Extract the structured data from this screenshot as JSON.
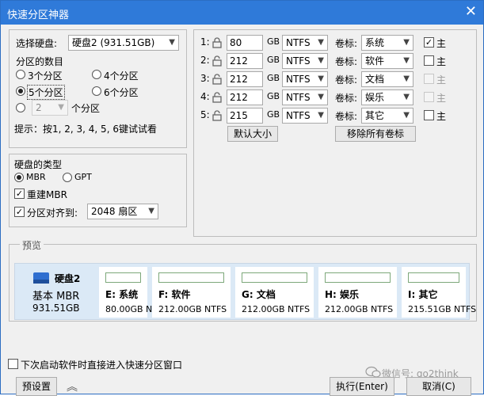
{
  "title": "快速分区神器",
  "disk": {
    "label": "选择硬盘:",
    "selected": "硬盘2 (931.51GB)"
  },
  "count": {
    "label": "分区的数目",
    "options": [
      "3个分区",
      "4个分区",
      "5个分区",
      "6个分区"
    ],
    "selected": "5个分区",
    "custom_value": "2",
    "custom_suffix": "个分区"
  },
  "hint": "提示：按1, 2, 3, 4, 5, 6键试试看",
  "disk_type": {
    "label": "硬盘的类型",
    "mbr": "MBR",
    "gpt": "GPT",
    "selected": "MBR",
    "rebuild_mbr": "重建MBR",
    "rebuild_checked": true,
    "align_label": "分区对齐到:",
    "align_checked": true,
    "align_value": "2048 扇区"
  },
  "partitions": [
    {
      "index": "1:",
      "size": "80",
      "unit": "GB",
      "fs": "NTFS",
      "vol_label": "卷标:",
      "vol": "系统",
      "primary": "主",
      "primary_checked": true,
      "primary_enabled": true
    },
    {
      "index": "2:",
      "size": "212",
      "unit": "GB",
      "fs": "NTFS",
      "vol_label": "卷标:",
      "vol": "软件",
      "primary": "主",
      "primary_checked": false,
      "primary_enabled": true
    },
    {
      "index": "3:",
      "size": "212",
      "unit": "GB",
      "fs": "NTFS",
      "vol_label": "卷标:",
      "vol": "文档",
      "primary": "主",
      "primary_checked": false,
      "primary_enabled": false
    },
    {
      "index": "4:",
      "size": "212",
      "unit": "GB",
      "fs": "NTFS",
      "vol_label": "卷标:",
      "vol": "娱乐",
      "primary": "主",
      "primary_checked": false,
      "primary_enabled": false
    },
    {
      "index": "5:",
      "size": "215",
      "unit": "GB",
      "fs": "NTFS",
      "vol_label": "卷标:",
      "vol": "其它",
      "primary": "主",
      "primary_checked": false,
      "primary_enabled": true
    }
  ],
  "buttons": {
    "default_size": "默认大小",
    "remove_labels": "移除所有卷标",
    "preset": "预设置",
    "execute": "执行(Enter)",
    "cancel": "取消(C)"
  },
  "preview": {
    "label": "预览",
    "disk_name": "硬盘2",
    "disk_type": "基本 MBR",
    "disk_size": "931.51GB",
    "parts": [
      {
        "name": "E: 系统",
        "size": "80.00GB NTFS"
      },
      {
        "name": "F: 软件",
        "size": "212.00GB NTFS"
      },
      {
        "name": "G: 文档",
        "size": "212.00GB NTFS"
      },
      {
        "name": "H: 娱乐",
        "size": "212.00GB NTFS"
      },
      {
        "name": "I: 其它",
        "size": "215.51GB NTFS"
      }
    ]
  },
  "startup_option": "下次启动软件时直接进入快速分区窗口",
  "watermark": "微信号: go2think",
  "colors": {
    "titlebar": "#2f7ad9",
    "disk_icon": "#2f6fd0",
    "preview_bg": "#dbe9f6"
  }
}
